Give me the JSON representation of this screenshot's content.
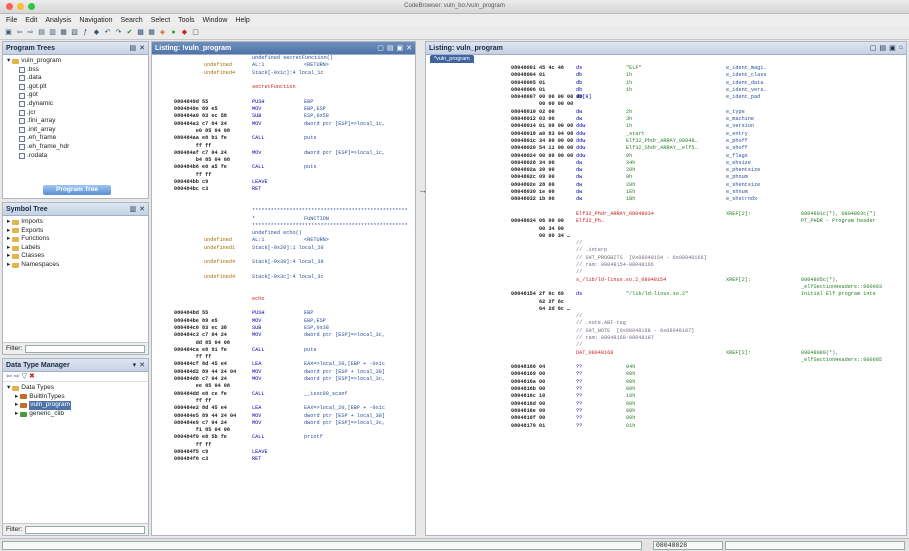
{
  "window": {
    "title": "CodeBrowser: vuln_bo:/vuln_program"
  },
  "menu": [
    "File",
    "Edit",
    "Analysis",
    "Navigation",
    "Search",
    "Select",
    "Tools",
    "Window",
    "Help"
  ],
  "program_trees": {
    "title": "Program Trees",
    "root": "vuln_program",
    "items": [
      ".bss",
      ".data",
      ".got.plt",
      ".got",
      ".dynamic",
      ".jcr",
      ".fini_array",
      ".init_array",
      ".eh_frame",
      ".eh_frame_hdr",
      ".rodata"
    ],
    "tab_label": "Program Tree"
  },
  "symbol_tree": {
    "title": "Symbol Tree",
    "items": [
      "Imports",
      "Exports",
      "Functions",
      "Labels",
      "Classes",
      "Namespaces"
    ],
    "filter_label": "Filter:"
  },
  "data_type_manager": {
    "title": "Data Type Manager",
    "root": "Data Types",
    "items": [
      "BuiltInTypes",
      "vuln_program",
      "generic_clib"
    ],
    "filter_label": "Filter:"
  },
  "listing_left": {
    "title": "Listing: !vuln_program",
    "lines": [
      {
        "a": "",
        "b": "",
        "c": "undefined secretFunction()",
        "d": "",
        "e": ""
      },
      {
        "a": "",
        "b": "undefined",
        "c": "AL:1",
        "d": "<RETURN>",
        "e": ""
      },
      {
        "a": "",
        "b": "undefined4",
        "c": "Stack[-0x1c]:4 local_1c",
        "d": "",
        "e": ""
      },
      {
        "a": "",
        "b": "",
        "c": "",
        "d": "",
        "e": ""
      },
      {
        "a": "",
        "b": "",
        "c": "secretFunction",
        "d": "",
        "e": ""
      },
      {
        "a": "",
        "b": "",
        "c": "",
        "d": "",
        "e": ""
      },
      {
        "a": "0804849d 55",
        "b": "",
        "c": "PUSH",
        "d": "EBP",
        "e": ""
      },
      {
        "a": "0804849e 89 e5",
        "b": "",
        "c": "MOV",
        "d": "EBP,ESP",
        "e": ""
      },
      {
        "a": "080484a0 83 ec 58",
        "b": "",
        "c": "SUB",
        "d": "ESP,0x58",
        "e": ""
      },
      {
        "a": "080484a3 c7 04 24",
        "b": "",
        "c": "MOV",
        "d": "dword ptr [ESP]=>local_1c,",
        "e": ""
      },
      {
        "a": "       e0 85 04 08",
        "b": "",
        "c": "",
        "d": "",
        "e": ""
      },
      {
        "a": "080484aa e8 b1 fe",
        "b": "",
        "c": "CALL",
        "d": "puts",
        "e": ""
      },
      {
        "a": "       ff ff",
        "b": "",
        "c": "",
        "d": "",
        "e": ""
      },
      {
        "a": "080484af c7 04 24",
        "b": "",
        "c": "MOV",
        "d": "dword ptr [ESP]=>local_1c,",
        "e": ""
      },
      {
        "a": "       b4 85 04 08",
        "b": "",
        "c": "",
        "d": "",
        "e": ""
      },
      {
        "a": "080484b6 e8 a5 fe",
        "b": "",
        "c": "CALL",
        "d": "puts",
        "e": ""
      },
      {
        "a": "       ff ff",
        "b": "",
        "c": "",
        "d": "",
        "e": ""
      },
      {
        "a": "080484bb c9",
        "b": "",
        "c": "LEAVE",
        "d": "",
        "e": ""
      },
      {
        "a": "080484bc c3",
        "b": "",
        "c": "RET",
        "d": "",
        "e": ""
      },
      {
        "a": "",
        "b": "",
        "c": "",
        "d": "",
        "e": ""
      },
      {
        "a": "",
        "b": "",
        "c": "",
        "d": "",
        "e": ""
      },
      {
        "a": "",
        "b": "",
        "c": "**************************************************",
        "d": "",
        "e": ""
      },
      {
        "a": "",
        "b": "",
        "c": "*",
        "d": "FUNCTION",
        "e": ""
      },
      {
        "a": "",
        "b": "",
        "c": "**************************************************",
        "d": "",
        "e": ""
      },
      {
        "a": "",
        "b": "",
        "c": "undefined echo()",
        "d": "",
        "e": ""
      },
      {
        "a": "",
        "b": "undefined",
        "c": "AL:1",
        "d": "<RETURN>",
        "e": ""
      },
      {
        "a": "",
        "b": "undefined1",
        "c": "Stack[-0x20]:1 local_20",
        "d": "",
        "e": ""
      },
      {
        "a": "",
        "b": "",
        "c": "",
        "d": "",
        "e": ""
      },
      {
        "a": "",
        "b": "undefined4",
        "c": "Stack[-0x38]:4 local_38",
        "d": "",
        "e": ""
      },
      {
        "a": "",
        "b": "",
        "c": "",
        "d": "",
        "e": ""
      },
      {
        "a": "",
        "b": "undefined4",
        "c": "Stack[-0x3c]:4 local_3c",
        "d": "",
        "e": ""
      },
      {
        "a": "",
        "b": "",
        "c": "",
        "d": "",
        "e": ""
      },
      {
        "a": "",
        "b": "",
        "c": "",
        "d": "",
        "e": ""
      },
      {
        "a": "",
        "b": "",
        "c": "echo",
        "d": "",
        "e": ""
      },
      {
        "a": "",
        "b": "",
        "c": "",
        "d": "",
        "e": ""
      },
      {
        "a": "080484bd 55",
        "b": "",
        "c": "PUSH",
        "d": "EBP",
        "e": ""
      },
      {
        "a": "080484be 89 e5",
        "b": "",
        "c": "MOV",
        "d": "EBP,ESP",
        "e": ""
      },
      {
        "a": "080484c0 83 ec 38",
        "b": "",
        "c": "SUB",
        "d": "ESP,0x38",
        "e": ""
      },
      {
        "a": "080484c3 c7 04 24",
        "b": "",
        "c": "MOV",
        "d": "dword ptr [ESP]=>local_3c,",
        "e": ""
      },
      {
        "a": "       dd 85 04 08",
        "b": "",
        "c": "",
        "d": "",
        "e": ""
      },
      {
        "a": "080484ca e8 91 fe",
        "b": "",
        "c": "CALL",
        "d": "puts",
        "e": ""
      },
      {
        "a": "       ff ff",
        "b": "",
        "c": "",
        "d": "",
        "e": ""
      },
      {
        "a": "080484cf 8d 45 e4",
        "b": "",
        "c": "LEA",
        "d": "EAX=>local_20,[EBP + -0x1c",
        "e": ""
      },
      {
        "a": "080484d2 89 44 24 04",
        "b": "",
        "c": "MOV",
        "d": "dword ptr [ESP + local_38]",
        "e": ""
      },
      {
        "a": "080484d6 c7 04 24",
        "b": "",
        "c": "MOV",
        "d": "dword ptr [ESP]=>local_3c,",
        "e": ""
      },
      {
        "a": "       ee 85 04 08",
        "b": "",
        "c": "",
        "d": "",
        "e": ""
      },
      {
        "a": "080484dd e8 ce fe",
        "b": "",
        "c": "CALL",
        "d": "__isoc99_scanf",
        "e": ""
      },
      {
        "a": "       ff ff",
        "b": "",
        "c": "",
        "d": "",
        "e": ""
      },
      {
        "a": "080484e2 8d 45 e4",
        "b": "",
        "c": "LEA",
        "d": "EAX=>local_20,[EBP + -0x1c",
        "e": ""
      },
      {
        "a": "080484e5 89 44 24 04",
        "b": "",
        "c": "MOV",
        "d": "dword ptr [ESP + local_38]",
        "e": ""
      },
      {
        "a": "080484e9 c7 04 24",
        "b": "",
        "c": "MOV",
        "d": "dword ptr [ESP]=>local_3c,",
        "e": ""
      },
      {
        "a": "       f1 85 04 08",
        "b": "",
        "c": "",
        "d": "",
        "e": ""
      },
      {
        "a": "080484f0 e8 5b fe",
        "b": "",
        "c": "CALL",
        "d": "printf",
        "e": ""
      },
      {
        "a": "       ff ff",
        "b": "",
        "c": "",
        "d": "",
        "e": ""
      },
      {
        "a": "080484f5 c9",
        "b": "",
        "c": "LEAVE",
        "d": "",
        "e": ""
      },
      {
        "a": "080484f6 c3",
        "b": "",
        "c": "RET",
        "d": "",
        "e": ""
      }
    ]
  },
  "listing_right": {
    "title": "Listing: vuln_program",
    "tab": "*vuln_program",
    "lines": [
      {
        "a": "08048001 45 4c 46",
        "b": "ds",
        "c": "\"ELF\"",
        "d": "e_ident_magi…",
        "e": ""
      },
      {
        "a": "08048004 01",
        "b": "db",
        "c": "1h",
        "d": "e_ident_class",
        "e": ""
      },
      {
        "a": "08048005 01",
        "b": "db",
        "c": "1h",
        "d": "e_ident_data",
        "e": ""
      },
      {
        "a": "08048006 01",
        "b": "db",
        "c": "1h",
        "d": "e_ident_vers…",
        "e": ""
      },
      {
        "a": "08048007 00 00 00 00 00",
        "b": "db[9]",
        "c": "",
        "d": "e_ident_pad",
        "e": ""
      },
      {
        "a": "         00 00 00 00",
        "b": "",
        "c": "",
        "d": "",
        "e": ""
      },
      {
        "a": "08048010 02 00",
        "b": "dw",
        "c": "2h",
        "d": "e_type",
        "e": ""
      },
      {
        "a": "08048012 03 00",
        "b": "dw",
        "c": "3h",
        "d": "e_machine",
        "e": ""
      },
      {
        "a": "08048014 01 00 00 00",
        "b": "ddw",
        "c": "1h",
        "d": "e_version",
        "e": ""
      },
      {
        "a": "08048018 a0 83 04 08",
        "b": "ddw",
        "c": "_start",
        "d": "e_entry",
        "e": ""
      },
      {
        "a": "0804801c 34 00 00 00",
        "b": "ddw",
        "c": "Elf32_Phdr_ARRAY_08048…",
        "d": "e_phoff",
        "e": ""
      },
      {
        "a": "08048020 54 11 00 00",
        "b": "ddw",
        "c": "Elf32_Shdr_ARRAY__elf5…",
        "d": "e_shoff",
        "e": ""
      },
      {
        "a": "08048024 00 00 00 00",
        "b": "ddw",
        "c": "0h",
        "d": "e_flags",
        "e": ""
      },
      {
        "a": "08048028 34 00",
        "b": "dw",
        "c": "34h",
        "d": "e_ehsize",
        "e": ""
      },
      {
        "a": "0804802a 20 00",
        "b": "dw",
        "c": "20h",
        "d": "e_phentsize",
        "e": ""
      },
      {
        "a": "0804802c 09 00",
        "b": "dw",
        "c": "9h",
        "d": "e_phnum",
        "e": ""
      },
      {
        "a": "0804802e 28 00",
        "b": "dw",
        "c": "28h",
        "d": "e_shentsize",
        "e": ""
      },
      {
        "a": "08048030 1e 00",
        "b": "dw",
        "c": "1Eh",
        "d": "e_shnum",
        "e": ""
      },
      {
        "a": "08048032 1b 00",
        "b": "dw",
        "c": "1Bh",
        "d": "e_shstrndx",
        "e": ""
      },
      {
        "a": "",
        "b": "",
        "c": "",
        "d": "",
        "e": ""
      },
      {
        "a": "",
        "b": "Elf32_Phdr_ARRAY_08048034",
        "c": "",
        "d": "XREF[2]:",
        "e": "0804801c(*), 0804803c(*)"
      },
      {
        "a": "08048034 06 00 00",
        "b": "Elf32_Ph…",
        "c": "",
        "d": "",
        "e": "PT_PHDR - Program header"
      },
      {
        "a": "         00 34 00",
        "b": "",
        "c": "",
        "d": "",
        "e": ""
      },
      {
        "a": "         00 00 34 …",
        "b": "",
        "c": "",
        "d": "",
        "e": ""
      },
      {
        "a": "",
        "b": "//",
        "c": "",
        "d": "",
        "e": ""
      },
      {
        "a": "",
        "b": "// .interp",
        "c": "",
        "d": "",
        "e": ""
      },
      {
        "a": "",
        "b": "// SHT_PROGBITS  [0x08048154 - 0x08048166]",
        "c": "",
        "d": "",
        "e": ""
      },
      {
        "a": "",
        "b": "// ram: 08048154-08048166",
        "c": "",
        "d": "",
        "e": ""
      },
      {
        "a": "",
        "b": "//",
        "c": "",
        "d": "",
        "e": ""
      },
      {
        "a": "",
        "b": "s_/lib/ld-linux.so.2_08048154",
        "c": "",
        "d": "XREF[2]:",
        "e": "0804805c(*),"
      },
      {
        "a": "",
        "b": "",
        "c": "",
        "d": "",
        "e": "_elfSectionHeaders::000003"
      },
      {
        "a": "08048154 2f 6c 69",
        "b": "ds",
        "c": "\"/lib/ld-linux.so.2\"",
        "d": "",
        "e": "Initial Elf program inte"
      },
      {
        "a": "         62 2f 6c",
        "b": "",
        "c": "",
        "d": "",
        "e": ""
      },
      {
        "a": "         64 2d 6c …",
        "b": "",
        "c": "",
        "d": "",
        "e": ""
      },
      {
        "a": "",
        "b": "//",
        "c": "",
        "d": "",
        "e": ""
      },
      {
        "a": "",
        "b": "// .note.ABI-tag",
        "c": "",
        "d": "",
        "e": ""
      },
      {
        "a": "",
        "b": "// SHT_NOTE  [0x08048168 - 0x08048187]",
        "c": "",
        "d": "",
        "e": ""
      },
      {
        "a": "",
        "b": "// ram: 08048168-08048187",
        "c": "",
        "d": "",
        "e": ""
      },
      {
        "a": "",
        "b": "//",
        "c": "",
        "d": "",
        "e": ""
      },
      {
        "a": "",
        "b": "DAT_08048168",
        "c": "",
        "d": "XREF[2]:",
        "e": "08048080(*),"
      },
      {
        "a": "",
        "b": "",
        "c": "",
        "d": "",
        "e": "_elfSectionHeaders::000005"
      },
      {
        "a": "08048168 04",
        "b": "??",
        "c": "04h",
        "d": "",
        "e": ""
      },
      {
        "a": "08048169 00",
        "b": "??",
        "c": "00h",
        "d": "",
        "e": ""
      },
      {
        "a": "0804816a 00",
        "b": "??",
        "c": "00h",
        "d": "",
        "e": ""
      },
      {
        "a": "0804816b 00",
        "b": "??",
        "c": "00h",
        "d": "",
        "e": ""
      },
      {
        "a": "0804816c 10",
        "b": "??",
        "c": "10h",
        "d": "",
        "e": ""
      },
      {
        "a": "0804816d 00",
        "b": "??",
        "c": "00h",
        "d": "",
        "e": ""
      },
      {
        "a": "0804816e 00",
        "b": "??",
        "c": "00h",
        "d": "",
        "e": ""
      },
      {
        "a": "0804816f 00",
        "b": "??",
        "c": "00h",
        "d": "",
        "e": ""
      },
      {
        "a": "08048170 01",
        "b": "??",
        "c": "01h",
        "d": "",
        "e": ""
      }
    ]
  },
  "status": {
    "address": "08048028"
  },
  "colors": {
    "accent": "#4d73a8",
    "panel_header": "#c5d2e3",
    "mnemonic": "#0000aa",
    "operand": "#2b4f9a",
    "xref": "#2a7d2a"
  }
}
